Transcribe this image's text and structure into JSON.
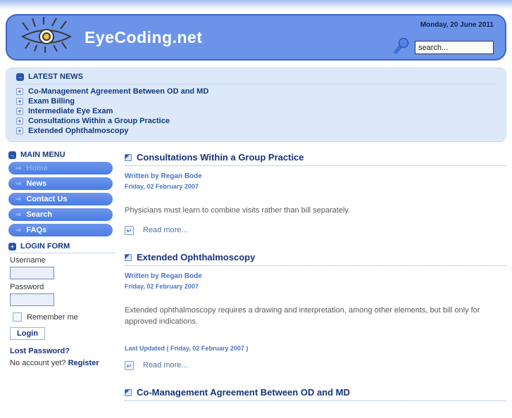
{
  "header": {
    "site_name": "EyeCoding.net",
    "date": "Monday, 20 June 2011",
    "search": {
      "value": "search..."
    }
  },
  "latest_news": {
    "title": "LATEST NEWS",
    "items": [
      "Co-Management Agreement Between OD and MD",
      "Exam Billing",
      "Intermediate Eye Exam",
      "Consultations Within a Group Practice",
      "Extended Ophthalmoscopy"
    ]
  },
  "main_menu": {
    "title": "MAIN MENU",
    "items": [
      {
        "label": "Home",
        "active": true
      },
      {
        "label": "News",
        "active": false
      },
      {
        "label": "Contact Us",
        "active": false
      },
      {
        "label": "Search",
        "active": false
      },
      {
        "label": "FAQs",
        "active": false
      }
    ]
  },
  "login_form": {
    "title": "LOGIN FORM",
    "username_label": "Username",
    "password_label": "Password",
    "remember_label": "Remember me",
    "login_button": "Login",
    "lost_password": "Lost Password?",
    "no_account": "No account yet?",
    "register": "Register"
  },
  "articles": [
    {
      "title": "Consultations Within a Group Practice",
      "author": "Written by Regan Bode",
      "date": "Friday, 02 February 2007",
      "body": "Physicians must learn to combine visits rather than bill separately.",
      "read_more": "Read more..."
    },
    {
      "title": "Extended Ophthalmoscopy",
      "author": "Written by Regan Bode",
      "date": "Friday, 02 February 2007",
      "body": "Extended ophthalmoscopy requires a drawing and interpretation, among other elements, but bill only for approved indications.",
      "last_updated": "Last Updated ( Friday, 02 February 2007 )",
      "read_more": "Read more..."
    },
    {
      "title": "Co-Management Agreement Between OD and MD"
    }
  ],
  "icons": {
    "module_arrow": "→",
    "module_plus": "+",
    "menu_arrow": "⇒",
    "news_item_plus": "+",
    "read_more_arrow": "↵"
  },
  "colors": {
    "header_blue": "#6b94e9",
    "header_border": "#3c64cd",
    "news_box_bg": "#dde9f8",
    "menu_button_blue": "#4a7de4",
    "link_navy": "#16327c",
    "byline_blue": "#4a76c4"
  }
}
